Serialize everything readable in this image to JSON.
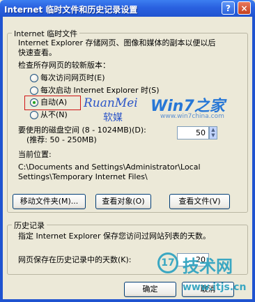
{
  "window": {
    "title": "Internet 临时文件和历史记录设置",
    "help_glyph": "?",
    "close_glyph": "×"
  },
  "temp_files": {
    "legend": "Internet 临时文件",
    "desc_line1": "Internet Explorer 存储网页、图像和媒体的副本以便以后",
    "desc_line2": "快速查看。",
    "check_label": "检查所存网页的较新版本：",
    "options": [
      {
        "label": "每次访问网页时(E)",
        "checked": false
      },
      {
        "label": "每次启动 Internet Explorer 时(S)",
        "checked": false
      },
      {
        "label": "自动(A)",
        "checked": true
      },
      {
        "label": "从不(N)",
        "checked": false
      }
    ],
    "disk_label_line1": "要使用的磁盘空间 (8 - 1024MB)(D):",
    "disk_label_line2": "(推荐: 50 - 250MB)",
    "disk_value": "50",
    "location_label": "当前位置:",
    "location_line1": "C:\\Documents and Settings\\Administrator\\Local",
    "location_line2": "Settings\\Temporary Internet Files\\",
    "buttons": {
      "move": "移动文件夹(M)...",
      "view_objects": "查看对象(O)",
      "view_files": "查看文件(V)"
    }
  },
  "history": {
    "legend": "历史记录",
    "desc": "指定 Internet Explorer 保存您访问过网站列表的天数。",
    "days_label": "网页保存在历史记录中的天数(K):",
    "days_value": "20"
  },
  "footer": {
    "ok": "确定",
    "cancel": "取消"
  },
  "watermarks": {
    "ruanmei_en": "RuanMei",
    "ruanmei_cn": "软媒",
    "win7_logo": "Win7之家",
    "win7_url": "www.win7china.com",
    "itjs_logo": "技术网",
    "itjs_url": "www.itjs.cn"
  },
  "colors": {
    "title_bar": "#2a61e0",
    "dialog_bg": "#ece9d8",
    "highlight": "#d01414",
    "radio_dot": "#21a121"
  }
}
